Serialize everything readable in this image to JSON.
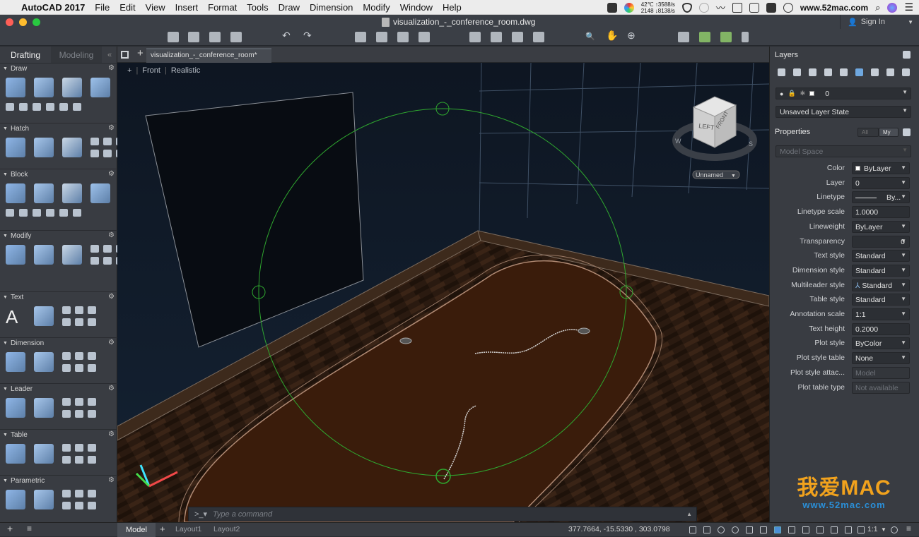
{
  "menubar": {
    "app_name": "AutoCAD 2017",
    "items": [
      "File",
      "Edit",
      "View",
      "Insert",
      "Format",
      "Tools",
      "Draw",
      "Dimension",
      "Modify",
      "Window",
      "Help"
    ],
    "temp": "42℃",
    "cpu_value": "2148",
    "net_up": "↑3588/s",
    "net_down": "↓8138/s",
    "site": "www.52mac.com"
  },
  "titlebar": {
    "document_title": "visualization_-_conference_room.dwg",
    "signin_label": "Sign In"
  },
  "left_panel": {
    "tabs": [
      "Drafting",
      "Modeling"
    ],
    "sections": [
      "Draw",
      "Hatch",
      "Block",
      "Modify",
      "Text",
      "Dimension",
      "Leader",
      "Table",
      "Parametric"
    ]
  },
  "document_tab": {
    "label": "visualization_-_conference_room*"
  },
  "viewport": {
    "view_name": "Front",
    "visual_style": "Realistic",
    "viewcube_faces": [
      "LEFT",
      "FRONT"
    ],
    "compass": [
      "W",
      "S"
    ],
    "ucs_label": "Unnamed",
    "command_placeholder": "Type a command"
  },
  "layers": {
    "title": "Layers",
    "current_layer": "0",
    "layer_state": "Unsaved Layer State"
  },
  "properties": {
    "title": "Properties",
    "filter_all": "All",
    "filter_my": "My",
    "space": "Model Space",
    "rows": [
      {
        "label": "Color",
        "value": "ByLayer"
      },
      {
        "label": "Layer",
        "value": "0"
      },
      {
        "label": "Linetype",
        "value": "By..."
      },
      {
        "label": "Linetype scale",
        "value": "1.0000"
      },
      {
        "label": "Lineweight",
        "value": "ByLayer"
      },
      {
        "label": "Transparency",
        "value": "0"
      },
      {
        "label": "Text style",
        "value": "Standard"
      },
      {
        "label": "Dimension style",
        "value": "Standard"
      },
      {
        "label": "Multileader style",
        "value": "Standard"
      },
      {
        "label": "Table style",
        "value": "Standard"
      },
      {
        "label": "Annotation scale",
        "value": "1:1"
      },
      {
        "label": "Text height",
        "value": "0.2000"
      },
      {
        "label": "Plot style",
        "value": "ByColor"
      },
      {
        "label": "Plot style table",
        "value": "None"
      },
      {
        "label": "Plot style attac...",
        "value": "Model"
      },
      {
        "label": "Plot table type",
        "value": "Not available"
      }
    ]
  },
  "statusbar": {
    "tabs": [
      "Model",
      "Layout1",
      "Layout2"
    ],
    "coordinates": "377.7664, -15.5330 , 303.0798",
    "scale": "1:1"
  },
  "watermark": {
    "main": "我爱MAC",
    "sub": "www.52mac.com"
  },
  "colors": {
    "accent": "#2a8fd8",
    "selection_circle": "#2fa82f",
    "floor": "#3a1c0b",
    "watermark": "#f1a21d"
  }
}
